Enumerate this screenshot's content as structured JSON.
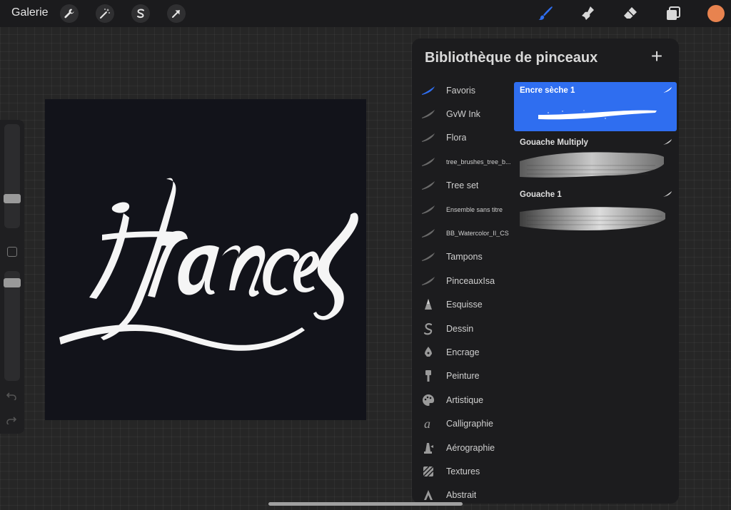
{
  "topbar": {
    "gallery_label": "Galerie",
    "left_tools": [
      "wrench-icon",
      "magic-wand-icon",
      "selection-s-icon",
      "arrow-icon"
    ],
    "right_tools": [
      "brush-icon",
      "smudge-icon",
      "eraser-icon",
      "layers-icon"
    ],
    "active_tool": "brush-icon",
    "active_tool_color": "#2f6ef0",
    "current_color": "#e8834f"
  },
  "canvas": {
    "background": "#12131a",
    "artwork_text": "france"
  },
  "panel": {
    "title": "Bibliothèque de pinceaux",
    "add_icon": "plus-icon",
    "brush_sets": [
      {
        "label": "Favoris",
        "icon": "stroke-icon",
        "selected": true
      },
      {
        "label": "GvW Ink",
        "icon": "stroke-icon"
      },
      {
        "label": "Flora",
        "icon": "stroke-icon"
      },
      {
        "label": "tree_brushes_tree_b...",
        "icon": "stroke-icon",
        "small": true
      },
      {
        "label": "Tree set",
        "icon": "stroke-icon"
      },
      {
        "label": "Ensemble sans titre",
        "icon": "stroke-icon",
        "small": true
      },
      {
        "label": "BB_Watercolor_II_CS",
        "icon": "stroke-icon",
        "small": true
      },
      {
        "label": "Tampons",
        "icon": "stroke-icon"
      },
      {
        "label": "PinceauxIsa",
        "icon": "stroke-icon"
      },
      {
        "label": "Esquisse",
        "icon": "pencil-tip-icon"
      },
      {
        "label": "Dessin",
        "icon": "squiggle-icon"
      },
      {
        "label": "Encrage",
        "icon": "pen-nib-icon"
      },
      {
        "label": "Peinture",
        "icon": "paint-brush-icon"
      },
      {
        "label": "Artistique",
        "icon": "palette-icon"
      },
      {
        "label": "Calligraphie",
        "icon": "calligraphy-a-icon"
      },
      {
        "label": "Aérographie",
        "icon": "airbrush-icon"
      },
      {
        "label": "Textures",
        "icon": "texture-icon"
      },
      {
        "label": "Abstrait",
        "icon": "abstract-icon"
      }
    ],
    "brushes": [
      {
        "name": "Encre sèche 1",
        "selected": true
      },
      {
        "name": "Gouache Multiply",
        "selected": false
      },
      {
        "name": "Gouache 1",
        "selected": false
      }
    ]
  }
}
